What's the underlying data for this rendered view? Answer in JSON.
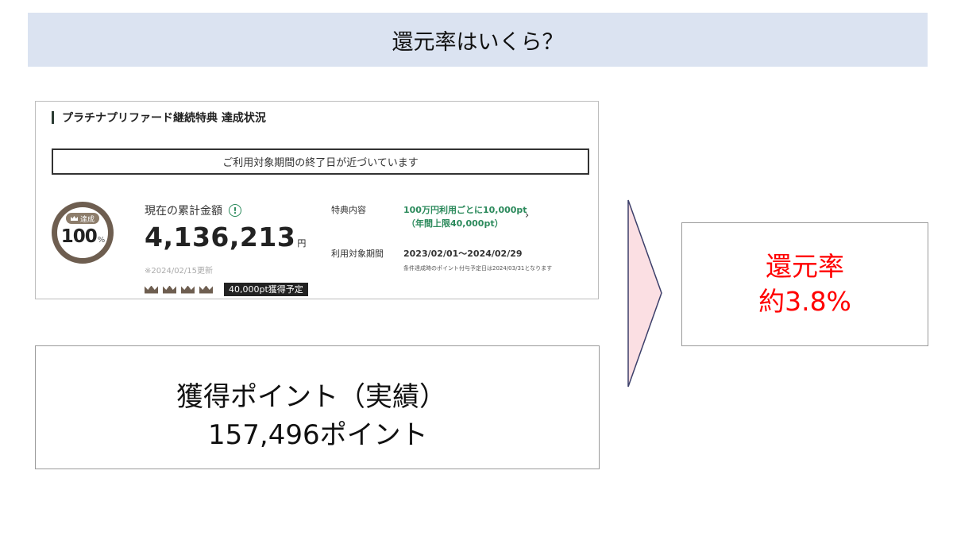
{
  "slide": {
    "title": "還元率はいくら？"
  },
  "status_card": {
    "title": "プラチナプリファード継続特典 達成状況",
    "notice": "ご利用対象期間の終了日が近づいています",
    "badge": {
      "tag": "達成",
      "percent": "100",
      "percent_sign": "%"
    },
    "amount_label": "現在の累計金額",
    "info_icon": "!",
    "amount_value": "4,136,213",
    "amount_unit": "円",
    "updated": "※2024/02/15更新",
    "crowns_count": 4,
    "points_tag": "40,000pt獲得予定",
    "benefit_label": "特典内容",
    "benefit_line1": "100万円利用ごとに10,000pt",
    "benefit_line2": "（年間上限40,000pt）",
    "benefit_chevron": "›",
    "period_label": "利用対象期間",
    "period_value": "2023/02/01〜2024/02/29",
    "period_note": "条件達成時のポイント付与予定日は2024/03/31となります"
  },
  "points_box": {
    "line1": "獲得ポイント（実績）",
    "line2": "157,496ポイント"
  },
  "rate_box": {
    "line1": "還元率",
    "line2": "約3.8%"
  },
  "colors": {
    "title_bg": "#dbe3f1",
    "accent_green": "#2c8a5c",
    "badge_brown": "#6e5e50",
    "rate_red": "#ff0000",
    "arrow_fill": "#fbdfe3"
  }
}
